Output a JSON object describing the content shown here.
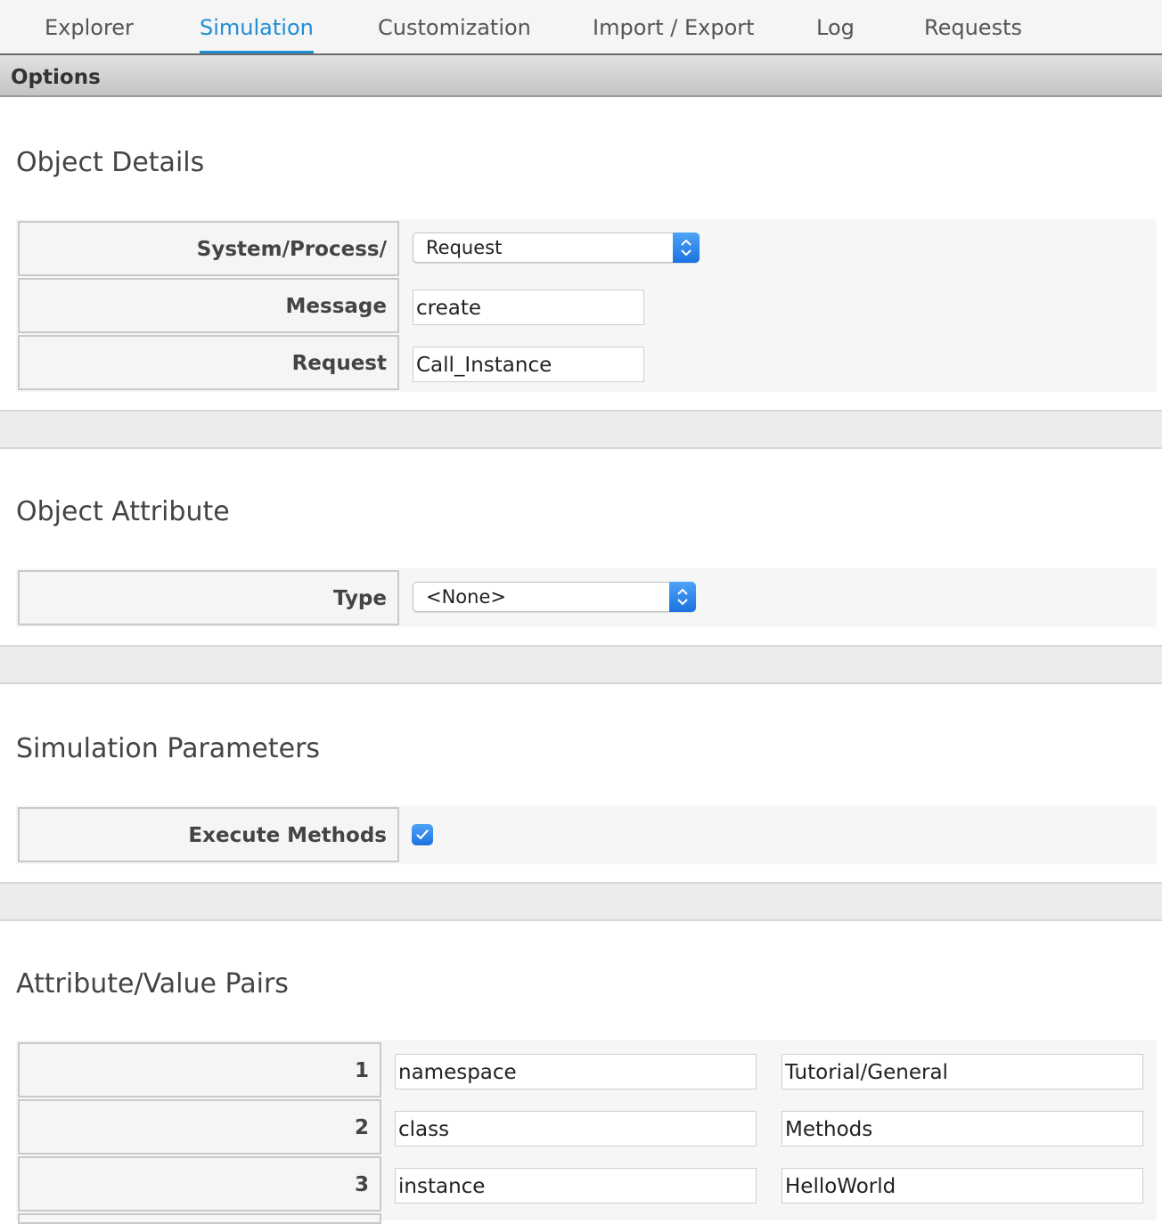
{
  "tabs": [
    {
      "label": "Explorer"
    },
    {
      "label": "Simulation"
    },
    {
      "label": "Customization"
    },
    {
      "label": "Import / Export"
    },
    {
      "label": "Log"
    },
    {
      "label": "Requests"
    }
  ],
  "active_tab": "Simulation",
  "options": {
    "title": "Options"
  },
  "object_details": {
    "title": "Object Details",
    "system_process_label": "System/Process/",
    "system_process_value": "Request",
    "message_label": "Message",
    "message_value": "create",
    "request_label": "Request",
    "request_value": "Call_Instance"
  },
  "object_attribute": {
    "title": "Object Attribute",
    "type_label": "Type",
    "type_value": "<None>"
  },
  "simulation_parameters": {
    "title": "Simulation Parameters",
    "execute_methods_label": "Execute Methods",
    "execute_methods_checked": true
  },
  "attribute_value_pairs": {
    "title": "Attribute/Value Pairs",
    "rows": [
      {
        "index": "1",
        "attribute": "namespace",
        "value": "Tutorial/General"
      },
      {
        "index": "2",
        "attribute": "class",
        "value": "Methods"
      },
      {
        "index": "3",
        "attribute": "instance",
        "value": "HelloWorld"
      }
    ]
  },
  "colors": {
    "accent": "#1f8dd6",
    "select_button": "#2a83ea"
  }
}
